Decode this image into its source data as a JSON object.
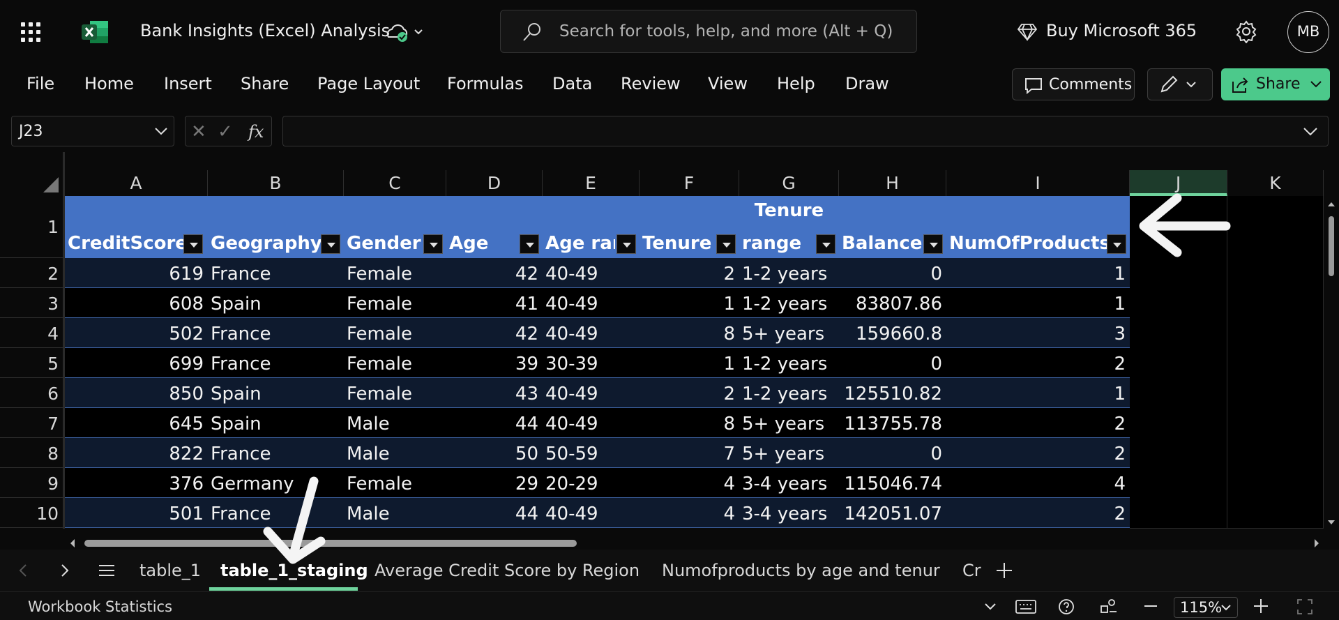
{
  "app": {
    "title": "Bank Insights (Excel) Analysis",
    "search_placeholder": "Search for tools, help, and more (Alt + Q)",
    "buy_label": "Buy Microsoft 365",
    "avatar_initials": "MB"
  },
  "menu": [
    "File",
    "Home",
    "Insert",
    "Share",
    "Page Layout",
    "Formulas",
    "Data",
    "Review",
    "View",
    "Help",
    "Draw"
  ],
  "actions": {
    "comments": "Comments",
    "share": "Share"
  },
  "formula_bar": {
    "name_box": "J23",
    "formula": ""
  },
  "columns": [
    "A",
    "B",
    "C",
    "D",
    "E",
    "F",
    "G",
    "H",
    "I",
    "J",
    "K"
  ],
  "rows": [
    "1",
    "2",
    "3",
    "4",
    "5",
    "6",
    "7",
    "8",
    "9",
    "10"
  ],
  "table": {
    "headers": [
      "CreditScore",
      "Geography",
      "Gender",
      "Age",
      "Age ran",
      "Tenure",
      "range",
      "Balance",
      "NumOfProducts"
    ],
    "header_top_line": {
      "G": "Tenure"
    },
    "data": [
      [
        "619",
        "France",
        "Female",
        "42",
        "40-49",
        "2",
        "1-2 years",
        "0",
        "1"
      ],
      [
        "608",
        "Spain",
        "Female",
        "41",
        "40-49",
        "1",
        "1-2 years",
        "83807.86",
        "1"
      ],
      [
        "502",
        "France",
        "Female",
        "42",
        "40-49",
        "8",
        "5+ years",
        "159660.8",
        "3"
      ],
      [
        "699",
        "France",
        "Female",
        "39",
        "30-39",
        "1",
        "1-2 years",
        "0",
        "2"
      ],
      [
        "850",
        "Spain",
        "Female",
        "43",
        "40-49",
        "2",
        "1-2 years",
        "125510.82",
        "1"
      ],
      [
        "645",
        "Spain",
        "Male",
        "44",
        "40-49",
        "8",
        "5+ years",
        "113755.78",
        "2"
      ],
      [
        "822",
        "France",
        "Male",
        "50",
        "50-59",
        "7",
        "5+ years",
        "0",
        "2"
      ],
      [
        "376",
        "Germany",
        "Female",
        "29",
        "20-29",
        "4",
        "3-4 years",
        "115046.74",
        "4"
      ],
      [
        "501",
        "France",
        "Male",
        "44",
        "40-49",
        "4",
        "3-4 years",
        "142051.07",
        "2"
      ]
    ]
  },
  "sheet_tabs": [
    "table_1",
    "table_1_staging",
    "Average Credit Score by Region",
    "Numofproducts by age and tenur",
    "Cr"
  ],
  "active_tab": "table_1_staging",
  "status": {
    "left": "Workbook Statistics",
    "zoom": "115%"
  },
  "colors": {
    "accent": "#4cc98b",
    "table_header": "#4472c4",
    "band": "#0e1a2e"
  }
}
